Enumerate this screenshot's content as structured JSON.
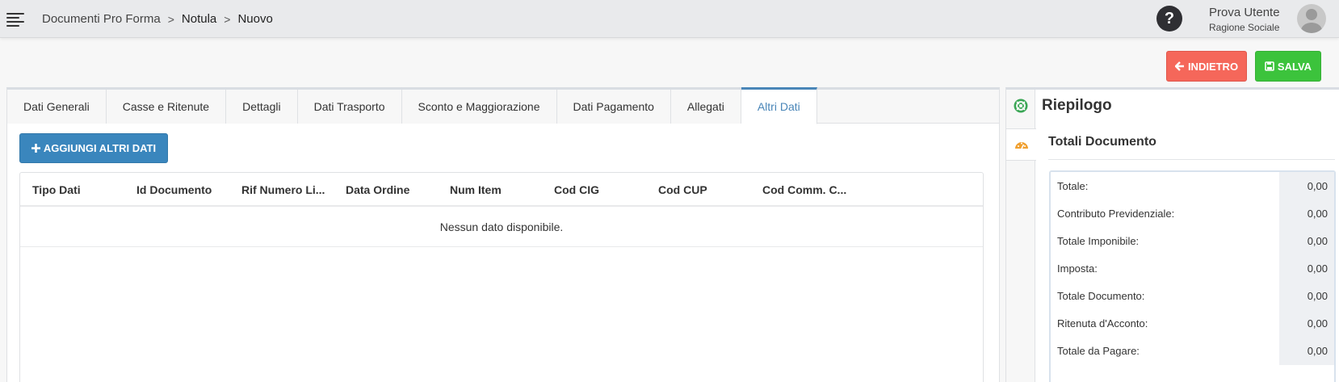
{
  "header": {
    "breadcrumb": [
      "Documenti Pro Forma",
      "Notula",
      "Nuovo"
    ],
    "separator": ">",
    "user_name": "Prova Utente",
    "user_company": "Ragione Sociale",
    "help_label": "?"
  },
  "actions": {
    "back_label": "INDIETRO",
    "save_label": "SALVA",
    "back_color": "#f5675a",
    "save_color": "#3cc33c"
  },
  "tabs": [
    {
      "label": "Dati Generali"
    },
    {
      "label": "Casse e Ritenute"
    },
    {
      "label": "Dettagli"
    },
    {
      "label": "Dati Trasporto"
    },
    {
      "label": "Sconto e Maggiorazione"
    },
    {
      "label": "Dati Pagamento"
    },
    {
      "label": "Allegati"
    },
    {
      "label": "Altri Dati",
      "active": true
    }
  ],
  "add_button_label": "AGGIUNGI ALTRI DATI",
  "grid": {
    "columns": [
      "Tipo Dati",
      "Id Documento",
      "Rif Numero Li...",
      "Data Ordine",
      "Num Item",
      "Cod CIG",
      "Cod CUP",
      "Cod Comm. C..."
    ],
    "empty_text": "Nessun dato disponibile."
  },
  "summary": {
    "title": "Riepilogo",
    "subtitle": "Totali Documento",
    "rows": [
      {
        "label": "Totale:",
        "value": "0,00"
      },
      {
        "label": "Contributo Previdenziale:",
        "value": "0,00"
      },
      {
        "label": "Totale Imponibile:",
        "value": "0,00"
      },
      {
        "label": "Imposta:",
        "value": "0,00"
      },
      {
        "label": "Totale Documento:",
        "value": "0,00"
      },
      {
        "label": "Ritenuta d'Acconto:",
        "value": "0,00"
      },
      {
        "label": "Totale da Pagare:",
        "value": "0,00"
      }
    ]
  },
  "icons": {
    "menu": "hamburger-menu-icon",
    "help": "question-circle-icon",
    "avatar": "user-avatar-icon",
    "back": "arrow-left-icon",
    "save": "floppy-disk-icon",
    "add": "plus-icon",
    "summary_tab": "life-ring-icon",
    "dashboard_tab": "dashboard-gauge-icon"
  }
}
